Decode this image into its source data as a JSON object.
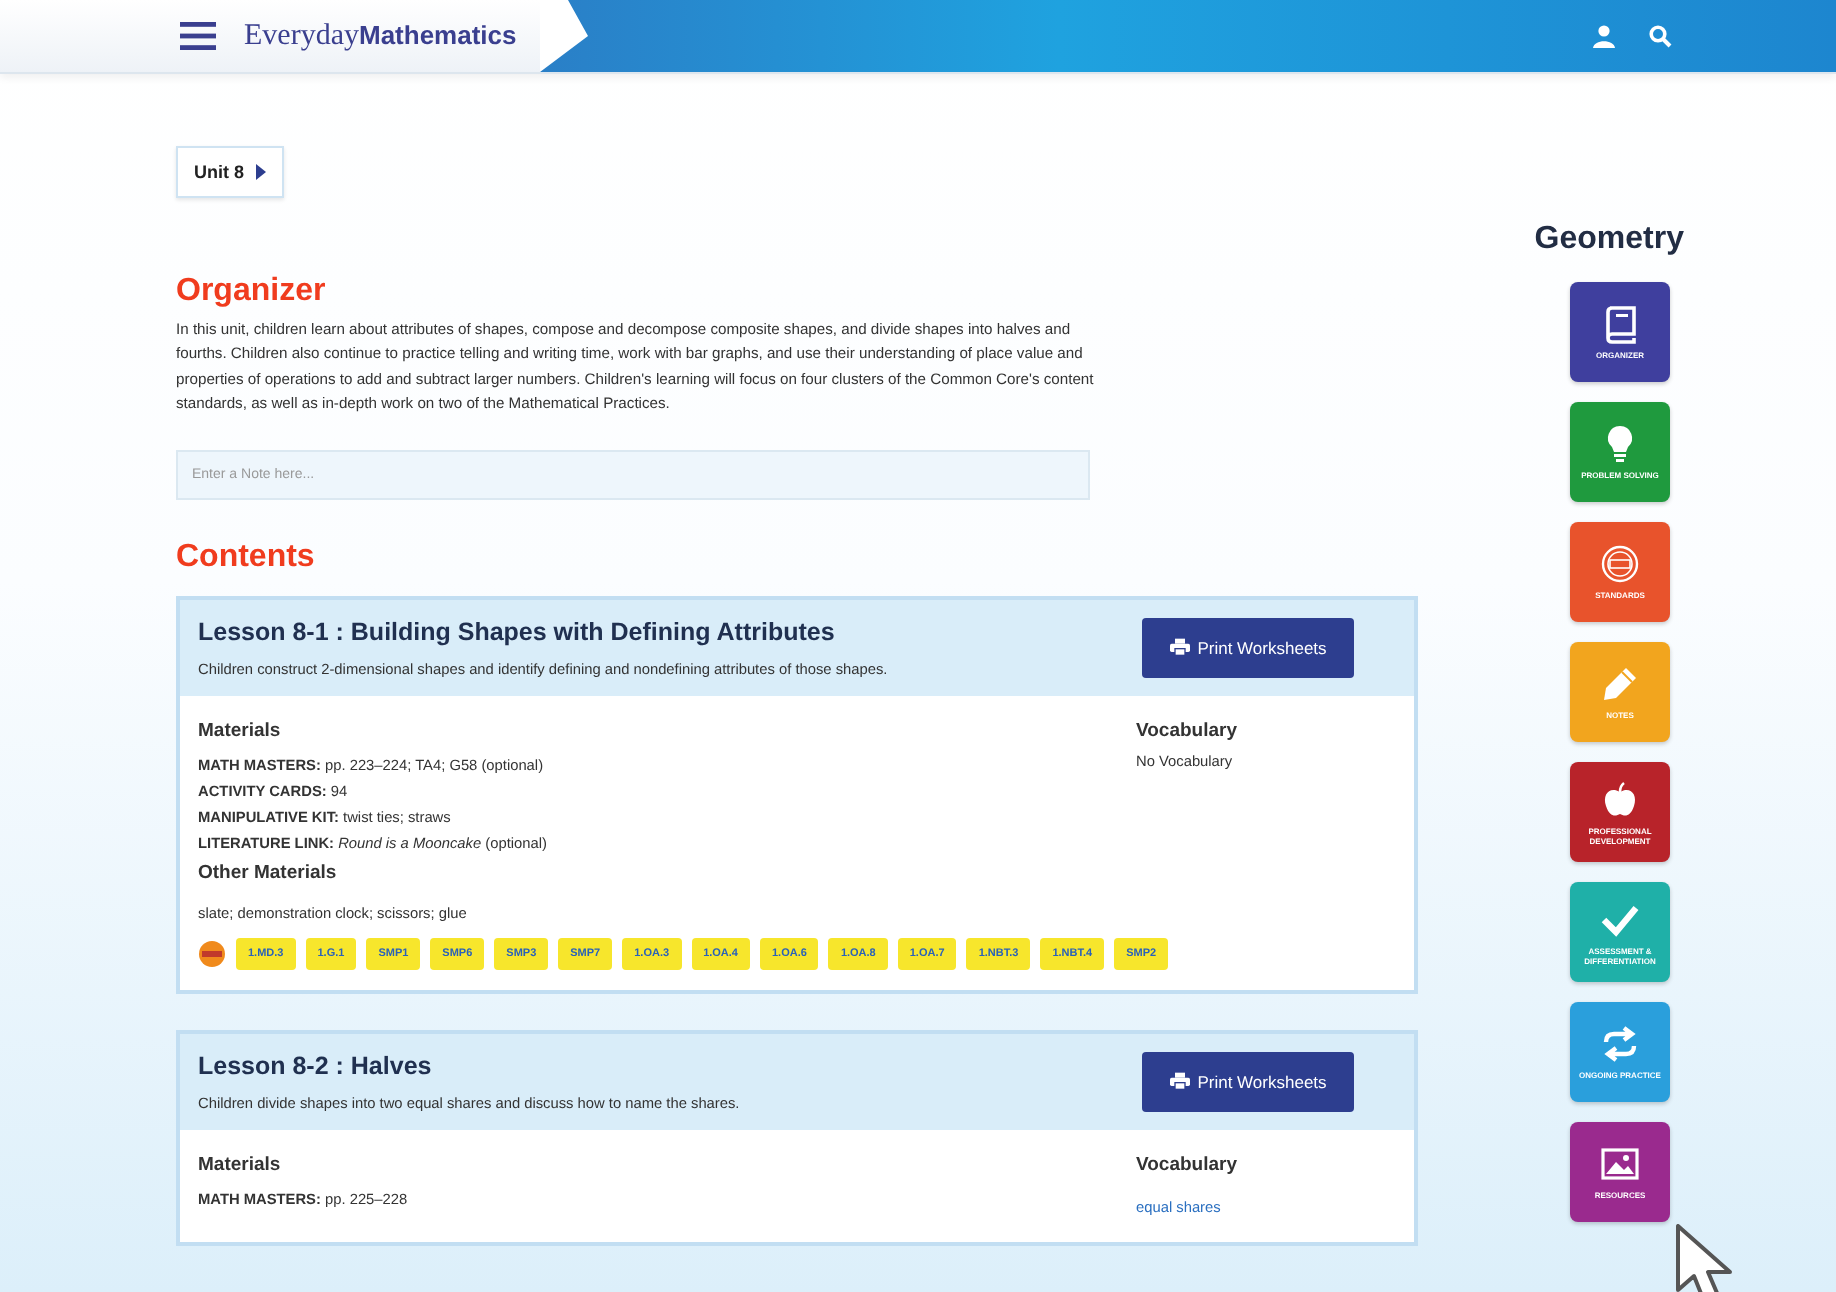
{
  "header": {
    "logo_light": "Everyday",
    "logo_bold": "Mathematics"
  },
  "unit_button": {
    "label": "Unit 8"
  },
  "page_title": "Geometry",
  "organizer": {
    "heading": "Organizer",
    "text": "In this unit, children learn about attributes of shapes, compose and decompose composite shapes, and divide shapes into halves and fourths. Children also continue to practice telling and writing time, work with bar graphs, and use their understanding of place value and properties of operations to add and subtract larger numbers. Children's learning will focus on four clusters of the Common Core's content standards, as well as in-depth work on two of the Mathematical Practices.",
    "note_placeholder": "Enter a Note here..."
  },
  "contents": {
    "heading": "Contents",
    "lessons": [
      {
        "title": "Lesson 8-1 : Building Shapes with Defining Attributes",
        "summary": "Children construct 2-dimensional shapes and identify defining and nondefining attributes of those shapes.",
        "print_button": "Print Worksheets",
        "materials_heading": "Materials",
        "materials": [
          "**MATH MASTERS:** pp. 223–224; TA4; G58 (optional)",
          "**ACTIVITY CARDS:** 94",
          "**MANIPULATIVE KIT:** twist ties; straws",
          "**LITERATURE LINK:** *Round is a Mooncake* (optional)"
        ],
        "other_heading": "Other Materials",
        "other_materials": "slate; demonstration clock; scissors; glue",
        "vocabulary_heading": "Vocabulary",
        "vocabulary": [
          {
            "kind": "text",
            "label": "No Vocabulary"
          }
        ],
        "standards": [
          "1.MD.3",
          "1.G.1",
          "SMP1",
          "SMP6",
          "SMP3",
          "SMP7",
          "1.OA.3",
          "1.OA.4",
          "1.OA.6",
          "1.OA.8",
          "1.OA.7",
          "1.NBT.3",
          "1.NBT.4",
          "SMP2"
        ]
      },
      {
        "title": "Lesson 8-2 : Halves",
        "summary": "Children divide shapes into two equal shares and discuss how to name the shares.",
        "print_button": "Print Worksheets",
        "materials_heading": "Materials",
        "materials": [
          "**MATH MASTERS:** pp. 225–228"
        ],
        "vocabulary_heading": "Vocabulary",
        "vocabulary": [
          {
            "kind": "link",
            "label": "equal shares"
          }
        ]
      }
    ]
  },
  "nav": [
    {
      "kind": "book",
      "label": "ORGANIZER",
      "color": "#3f3f9e"
    },
    {
      "kind": "bulb",
      "label": "PROBLEM SOLVING",
      "color": "#1f9a3e"
    },
    {
      "kind": "ccss",
      "label": "STANDARDS",
      "color": "#e8532c"
    },
    {
      "kind": "pencil",
      "label": "NOTES",
      "color": "#f2a51e"
    },
    {
      "kind": "apple",
      "label": "PROFESSIONAL DEVELOPMENT",
      "color": "#b8232a"
    },
    {
      "kind": "check",
      "label": "ASSESSMENT & DIFFERENTIATION",
      "color": "#1fb0a8"
    },
    {
      "kind": "arrows",
      "label": "ONGOING PRACTICE",
      "color": "#2a9fdc"
    },
    {
      "kind": "image",
      "label": "RESOURCES",
      "color": "#9a2a8e"
    }
  ]
}
